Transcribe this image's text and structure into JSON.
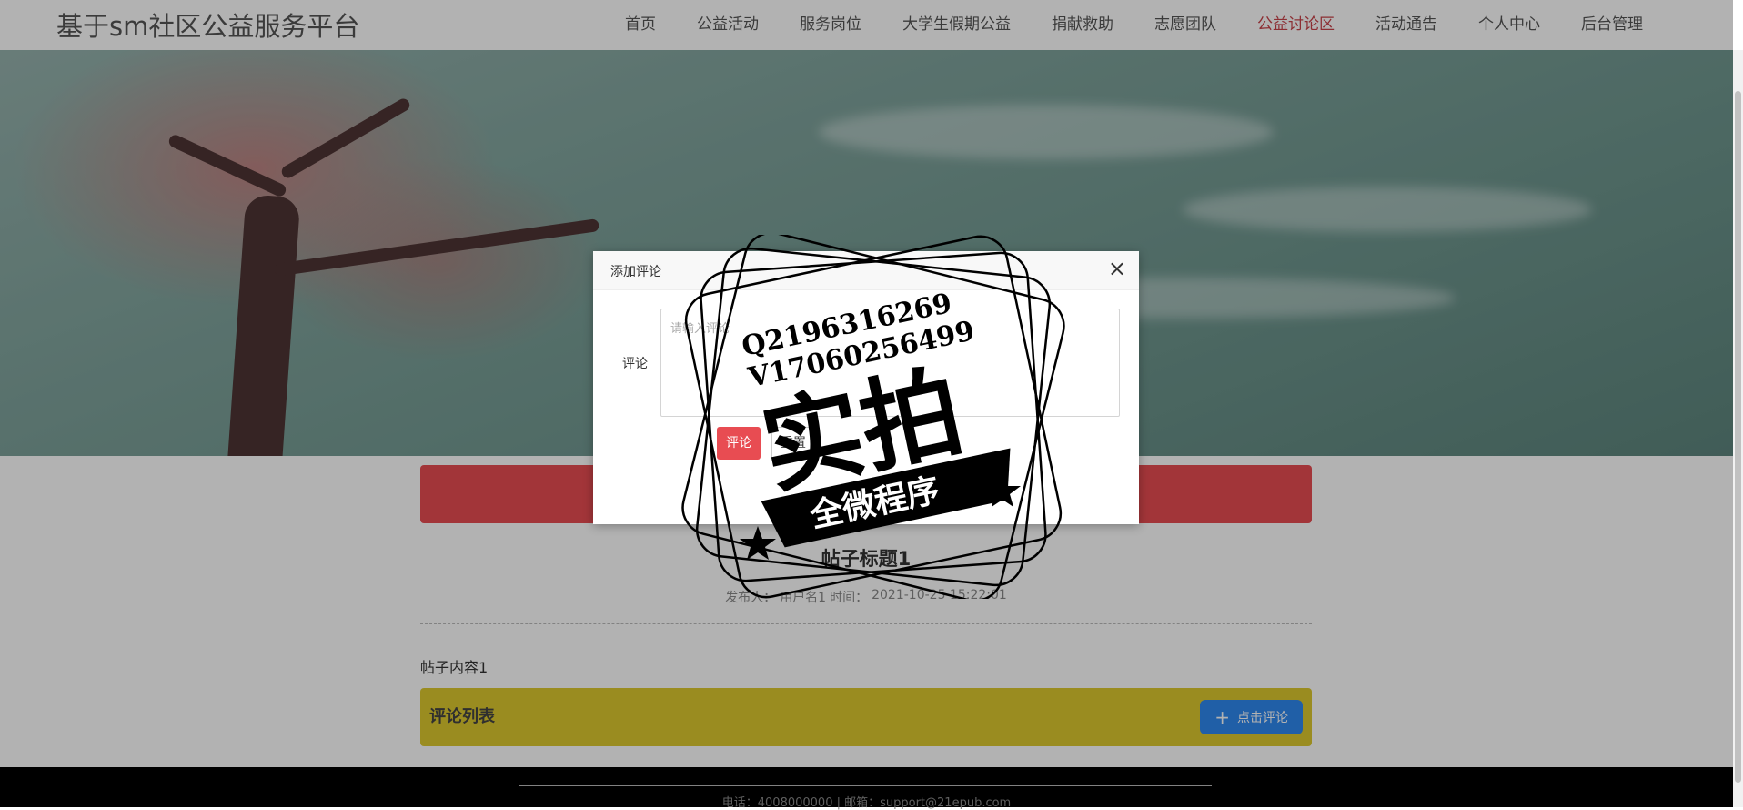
{
  "header": {
    "brand": "基于sm社区公益服务平台",
    "nav": [
      {
        "label": "首页"
      },
      {
        "label": "公益活动"
      },
      {
        "label": "服务岗位"
      },
      {
        "label": "大学生假期公益"
      },
      {
        "label": "捐献救助"
      },
      {
        "label": "志愿团队"
      },
      {
        "label": "公益讨论区"
      },
      {
        "label": "活动通告"
      },
      {
        "label": "个人中心"
      },
      {
        "label": "后台管理"
      }
    ],
    "active_nav": "公益讨论区",
    "active_color": "#c9434a"
  },
  "post": {
    "title": "帖子标题1",
    "author_label": "发布人：",
    "author": "用户名1",
    "time_label": "时间：",
    "time": "2021-10-25 15:22:01",
    "content": "帖子内容1"
  },
  "comments": {
    "title": "评论列表",
    "add_button": "点击评论"
  },
  "footer": {
    "text": "电话：4008000000 | 邮箱：support@21epub.com"
  },
  "modal": {
    "title": "添加评论",
    "field_label": "评论",
    "placeholder": "请输入评论",
    "submit": "评论",
    "reset": "重置"
  },
  "watermark": {
    "line1": "Q2196316269",
    "line2": "V17060256499",
    "main": "实拍",
    "ribbon": "全微程序"
  },
  "colors": {
    "banner_red": "#e84c52",
    "comment_bar": "#ddc92f",
    "button_blue": "#2f88f0"
  }
}
